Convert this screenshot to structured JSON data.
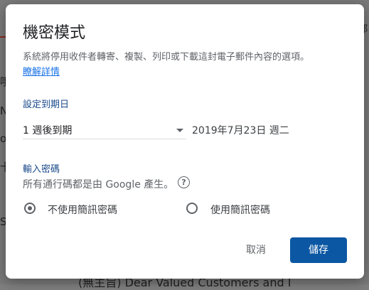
{
  "dialog": {
    "title": "機密模式",
    "description": "系統將停用收件者轉寄、複製、列印或下載這封電子郵件內容的選項。",
    "learn_more": "瞭解詳情"
  },
  "expiration": {
    "label": "設定到期日",
    "selected": "1 週後到期",
    "date": "2019年7月23日 週二"
  },
  "passcode": {
    "label": "輸入密碼",
    "description": "所有通行碼都是由 Google 產生。",
    "help_icon": "?",
    "options": [
      {
        "label": "不使用簡訊密碼",
        "checked": true
      },
      {
        "label": "使用簡訊密碼",
        "checked": false
      }
    ]
  },
  "buttons": {
    "cancel": "取消",
    "save": "儲存"
  },
  "background": {
    "footer_text": "(無主旨)  Dear Valued Customers and I"
  },
  "colors": {
    "accent": "#0b57a3",
    "link": "#1a73e8",
    "section_label": "#1a4a8a"
  }
}
